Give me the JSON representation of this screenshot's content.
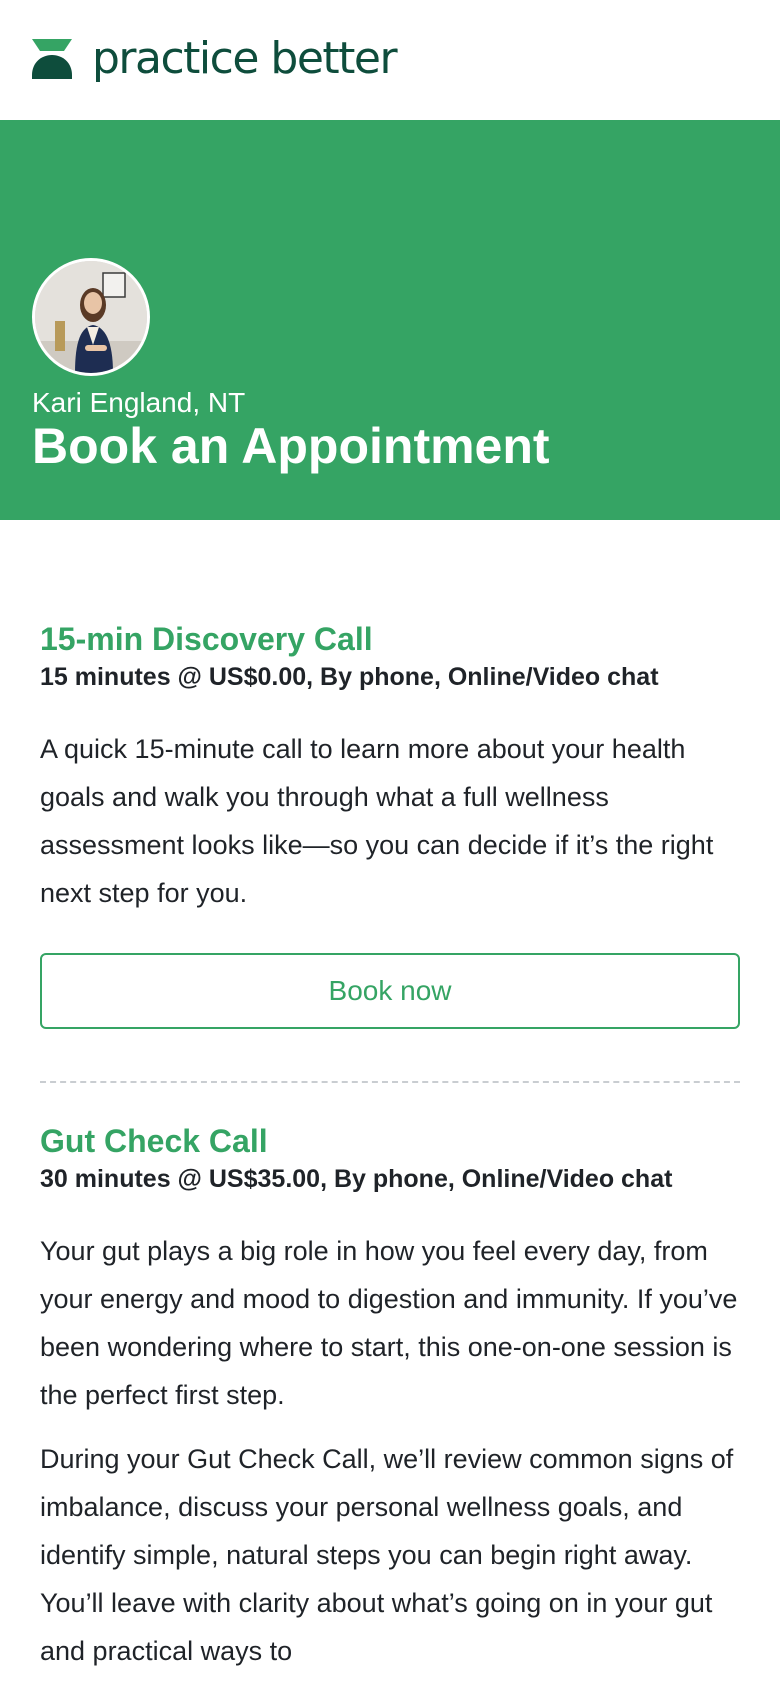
{
  "brand": {
    "name": "practice better",
    "color_dark": "#0e4d3c",
    "color_accent": "#35a464",
    "logo_icon": "practice-better-logo-mark"
  },
  "hero": {
    "background": "#35a464",
    "avatar_icon": "practitioner-photo",
    "practitioner": "Kari England, NT",
    "title": "Book an Appointment"
  },
  "services": [
    {
      "title": "15-min Discovery Call",
      "meta": "15 minutes @ US$0.00, By phone, Online/Video chat",
      "description": [
        "A quick 15-minute call to learn more about your health goals and walk you through what a full wellness assessment looks like—so you can decide if it’s the right next step for you."
      ],
      "button_label": "Book now"
    },
    {
      "title": "Gut Check Call",
      "meta": "30 minutes @ US$35.00, By phone, Online/Video chat",
      "description": [
        "Your gut plays a big role in how you feel every day, from your energy and mood to digestion and immunity. If you’ve been wondering where to start, this one-on-one session is the perfect first step.",
        "During your Gut Check Call, we’ll review common signs of imbalance, discuss your personal wellness goals, and identify simple, natural steps you can begin right away. You’ll leave with clarity about what’s going on in your gut and practical ways to"
      ]
    }
  ]
}
